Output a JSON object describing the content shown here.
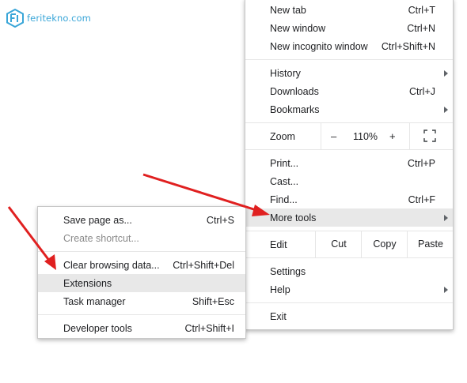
{
  "logo": {
    "text": "feritekno.com"
  },
  "main_menu": {
    "new_tab": {
      "label": "New tab",
      "shortcut": "Ctrl+T"
    },
    "new_window": {
      "label": "New window",
      "shortcut": "Ctrl+N"
    },
    "new_incognito": {
      "label": "New incognito window",
      "shortcut": "Ctrl+Shift+N"
    },
    "history": {
      "label": "History"
    },
    "downloads": {
      "label": "Downloads",
      "shortcut": "Ctrl+J"
    },
    "bookmarks": {
      "label": "Bookmarks"
    },
    "zoom": {
      "label": "Zoom",
      "minus": "–",
      "value": "110%",
      "plus": "+"
    },
    "print": {
      "label": "Print...",
      "shortcut": "Ctrl+P"
    },
    "cast": {
      "label": "Cast..."
    },
    "find": {
      "label": "Find...",
      "shortcut": "Ctrl+F"
    },
    "more_tools": {
      "label": "More tools"
    },
    "edit": {
      "label": "Edit",
      "cut": "Cut",
      "copy": "Copy",
      "paste": "Paste"
    },
    "settings": {
      "label": "Settings"
    },
    "help": {
      "label": "Help"
    },
    "exit": {
      "label": "Exit"
    }
  },
  "sub_menu": {
    "save_page": {
      "label": "Save page as...",
      "shortcut": "Ctrl+S"
    },
    "create_shortcut": {
      "label": "Create shortcut..."
    },
    "clear_browsing": {
      "label": "Clear browsing data...",
      "shortcut": "Ctrl+Shift+Del"
    },
    "extensions": {
      "label": "Extensions"
    },
    "task_manager": {
      "label": "Task manager",
      "shortcut": "Shift+Esc"
    },
    "developer_tools": {
      "label": "Developer tools",
      "shortcut": "Ctrl+Shift+I"
    }
  },
  "colors": {
    "annotation_arrow": "#e02020",
    "highlight": "#e8e8e8",
    "logo": "#3aa6d8"
  },
  "highlighted_items": [
    "More tools",
    "Extensions"
  ]
}
